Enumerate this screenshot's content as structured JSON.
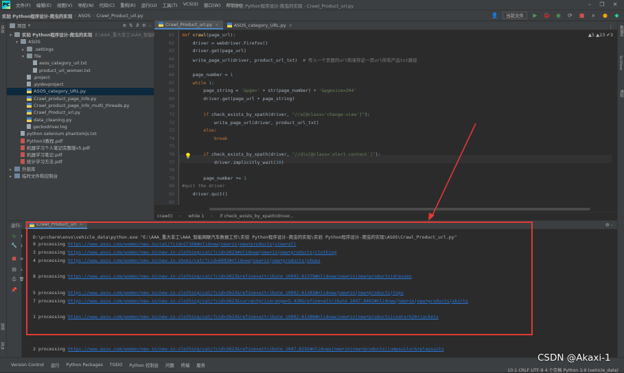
{
  "menubar": {
    "items": [
      "文件(F)",
      "编辑(E)",
      "视图(V)",
      "导航(N)",
      "代码(C)",
      "重构(R)",
      "运行(U)",
      "工具(T)",
      "VCS(S)",
      "窗口(W)",
      "帮助(H)"
    ],
    "window_title": "实验 Python程序设计-爬虫的实现 - Crawl_Product_url.py"
  },
  "navbar": {
    "crumbs": [
      "实验 Python程序设计-爬虫的实现",
      "ASOS",
      "Crawl_Product_url.py"
    ],
    "run_config": "当前文件"
  },
  "project": {
    "title": "项目",
    "tree": [
      {
        "label": "实验 Python程序设计-爬虫的实现",
        "hint": "E:\\AAA_重大非工\\AAA_智能网",
        "indent": 0,
        "icon": "folder",
        "tw": "▾",
        "bold": true
      },
      {
        "label": "ASOS",
        "indent": 1,
        "icon": "folder",
        "tw": "▾"
      },
      {
        "label": ".settings",
        "indent": 2,
        "icon": "folder",
        "tw": "▸"
      },
      {
        "label": "file",
        "indent": 2,
        "icon": "folder",
        "tw": "▾"
      },
      {
        "label": "asos_category_url.txt",
        "indent": 3,
        "icon": "txt",
        "tw": ""
      },
      {
        "label": "product_url_women.txt",
        "indent": 3,
        "icon": "txt",
        "tw": ""
      },
      {
        "label": ".project",
        "indent": 2,
        "icon": "file",
        "tw": ""
      },
      {
        "label": ".pydevproject",
        "indent": 2,
        "icon": "file",
        "tw": ""
      },
      {
        "label": "ASOS_category_URL.py",
        "indent": 2,
        "icon": "py",
        "tw": "",
        "sel": true
      },
      {
        "label": "Crawl_product_page_info.py",
        "indent": 2,
        "icon": "py",
        "tw": ""
      },
      {
        "label": "Crawl_product_page_info_multi_threads.py",
        "indent": 2,
        "icon": "py",
        "tw": ""
      },
      {
        "label": "Crawl_Product_url.py",
        "indent": 2,
        "icon": "py",
        "tw": ""
      },
      {
        "label": "data_cleaning.py",
        "indent": 2,
        "icon": "py",
        "tw": ""
      },
      {
        "label": "geckodriver.log",
        "indent": 2,
        "icon": "txt",
        "tw": ""
      },
      {
        "label": "python selenium phantomjs.txt",
        "indent": 1,
        "icon": "txt",
        "tw": ""
      },
      {
        "label": "Python3教程.pdf",
        "indent": 1,
        "icon": "pdf",
        "tw": ""
      },
      {
        "label": "机器学习个人笔记完整版v5.pdf",
        "indent": 1,
        "icon": "pdf",
        "tw": ""
      },
      {
        "label": "机器学习笔记.pdf",
        "indent": 1,
        "icon": "pdf",
        "tw": ""
      },
      {
        "label": "统计学习方法.pdf",
        "indent": 1,
        "icon": "pdf",
        "tw": ""
      },
      {
        "label": "外部库",
        "indent": 0,
        "icon": "lib",
        "tw": "▸"
      },
      {
        "label": "临时文件和控制台",
        "indent": 0,
        "icon": "lib",
        "tw": "▸"
      }
    ]
  },
  "editor": {
    "tabs": [
      "Crawl_Product_url.py",
      "ASOS_category_URL.py"
    ],
    "warnings": "▲5  ▲23  ✔3",
    "lines": [
      {
        "n": "61",
        "html": "<span class='kw'>def</span> <span class='fn'>crawl</span>(page_url):"
      },
      {
        "n": "62",
        "html": "    driver = webdriver.Firefox()"
      },
      {
        "n": "63",
        "html": "    driver.get(page_url)"
      },
      {
        "n": "64",
        "html": "    write_page_url(driver, product_url_txt)  <span class='cm'># 传入一个页面的url和保存这一页url所有产品txt路径</span>"
      },
      {
        "n": "65",
        "html": ""
      },
      {
        "n": "66",
        "html": "    page_number = <span class='num'>1</span>"
      },
      {
        "n": "67",
        "html": "    <span class='kw'>while</span> <span class='num'>1</span>:"
      },
      {
        "n": "68",
        "html": "        page_string = <span class='str'>'&amp;pge='</span> + str(page_number) + <span class='str'>'&amp;pgesize=204'</span>"
      },
      {
        "n": "69",
        "html": "        driver.get(page_url + page_string)"
      },
      {
        "n": "70",
        "html": ""
      },
      {
        "n": "71",
        "html": "        <span class='kw'>if</span> check_exists_by_xpath(driver, <span class='str'>\"//a[@class='change-view']\"</span>):"
      },
      {
        "n": "72",
        "html": "            write_page_url(driver, product_url_txt)"
      },
      {
        "n": "73",
        "html": "        <span class='kw'>else</span>:"
      },
      {
        "n": "74",
        "html": "            <span class='kw'>break</span>"
      },
      {
        "n": "75",
        "html": ""
      },
      {
        "n": "76",
        "html": "        <span class='kw'>if</span> check_exists_by_xpath(driver, <span class='str'>\"//div[@class='alert-content']\"</span>):"
      },
      {
        "n": "77",
        "html": "            driver.implicitly_wait(<span class='num'>10</span>)"
      },
      {
        "n": "78",
        "html": ""
      },
      {
        "n": "79",
        "html": "        page_number += <span class='num'>1</span>"
      },
      {
        "n": "80",
        "html": "<span class='cm'>#quit the driver</span>"
      },
      {
        "n": "81",
        "html": "    driver.quit()"
      },
      {
        "n": "82",
        "html": ""
      }
    ],
    "breadcrumb": [
      "crawl()",
      "while 1",
      "if check_exists_by_xpath(driver..."
    ]
  },
  "run": {
    "label": "运行:",
    "tab": "Crawl_Product_url",
    "cmd": "D:\\prcharm\\envs\\vehicle_data\\python.exe \"E:\\AAA_重大非工\\AAA_智能网联汽车数据工作\\实验 Python程序设计-爬虫的实现\\实验 Python程序设计-爬虫的实现\\ASOS\\Crawl_Product_url.py\"",
    "lines": [
      {
        "num": "9",
        "text": "processing",
        "url": "https://www.asos.com/women/new-in/cat/?cid=27108#nlid=ww|new+in|new+products|view+all",
        "gap": 0
      },
      {
        "num": "3",
        "text": "processing",
        "url": "https://www.asos.com/women/new-in/new-in-clothing/cat/?cid=2623#nlid=ww|new+in|new+products|clothing",
        "gap": 0
      },
      {
        "num": "4",
        "text": "processing",
        "url": "https://www.asos.com/women/new-in/new-in-shoes/cat/?cid=6992#nlid=ww|new+in|new+products|shoes",
        "gap": 0
      },
      {
        "num": "8",
        "text": "processing",
        "url": "https://www.asos.com/women/new-in/new-in-clothing/cat/?cid=2623&refine=attribute_10992:61379#nlid=ww|new+in|new+products|dresses",
        "gap": 1
      },
      {
        "num": "5",
        "text": "processing",
        "url": "https://www.asos.com/women/new-in/new-in-clothing/cat/?cid=2623&refine=attribute_10992:61383#nlid=ww|new+in|new+products|tops",
        "gap": 1
      },
      {
        "num": "7",
        "text": "processing",
        "url": "https://www.asos.com/women/new-in/new-in-clothing/cat/?cid=2623&currentpricerange=5-430&refine=attribute_1047:8402#nlid=ww|new+in|new+products|skirts",
        "gap": 0
      },
      {
        "num": "1",
        "text": "processing",
        "url": "https://www.asos.com/women/new-in/new-in-clothing/cat/?cid=2623&refine=attribute_10992:61380#nlid=ww|new+in|new+products|coats+%26+jackets",
        "gap": 1
      },
      {
        "num": "2",
        "text": "processing",
        "url": "https://www.asos.com/women/new-in/new-in-clothing/cat/?cid=2623&refine=attribute_1047:8192#nlid=ww|new+in|new+products|jumpsuits+&+playsuits",
        "gap": 3
      }
    ]
  },
  "statusbar": {
    "items": [
      "Version Control",
      "运行",
      "Python Packages",
      "TODO",
      "Python 控制台",
      "问题",
      "终端",
      "服务"
    ],
    "right": "10:1  CRLF  UTF-8  4 个空格  Python 3.9 (vehicle_data)"
  },
  "watermark": "CSDN @Akaxi-1",
  "colors": {
    "annotation": "#e53935",
    "link": "#287bde"
  },
  "side": {
    "left": [
      "项目",
      "结构",
      "书签"
    ],
    "right": [
      "数据库",
      "SciView",
      "通知"
    ]
  }
}
